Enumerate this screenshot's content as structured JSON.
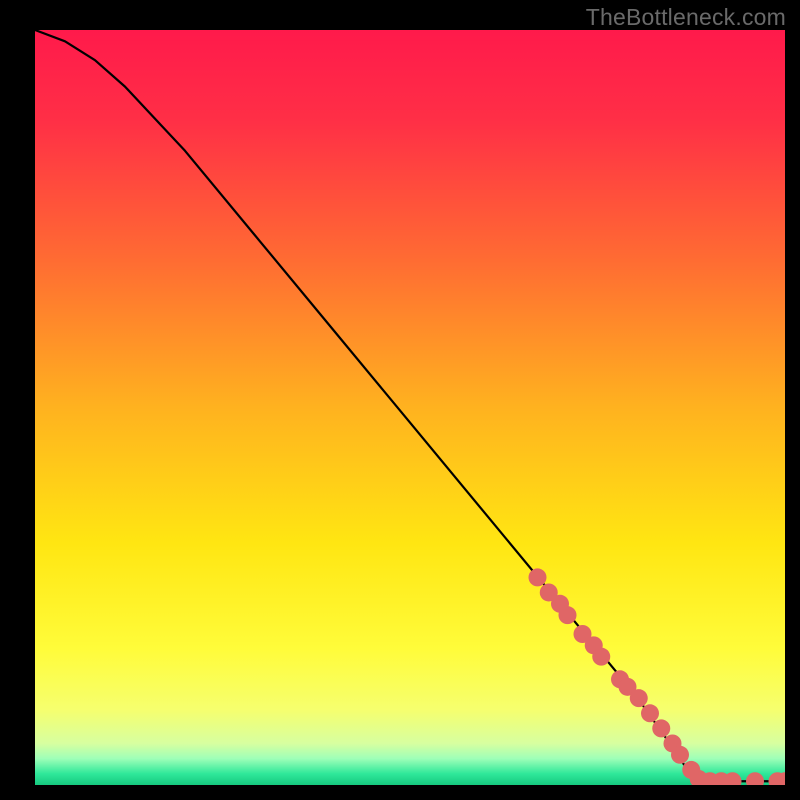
{
  "watermark": "TheBottleneck.com",
  "chart_data": {
    "type": "line",
    "title": "",
    "xlabel": "",
    "ylabel": "",
    "xlim": [
      0,
      100
    ],
    "ylim": [
      0,
      100
    ],
    "grid": false,
    "legend": false,
    "curve": {
      "comment": "Black descending curve; starts at top-left with slight outward bow then near-linear to bottom-right, flattening near x≈88.",
      "points": [
        {
          "x": 0,
          "y": 100
        },
        {
          "x": 4,
          "y": 98.5
        },
        {
          "x": 8,
          "y": 96
        },
        {
          "x": 12,
          "y": 92.5
        },
        {
          "x": 20,
          "y": 84
        },
        {
          "x": 30,
          "y": 72
        },
        {
          "x": 40,
          "y": 60
        },
        {
          "x": 50,
          "y": 48
        },
        {
          "x": 60,
          "y": 36
        },
        {
          "x": 70,
          "y": 24
        },
        {
          "x": 80,
          "y": 12
        },
        {
          "x": 85,
          "y": 5
        },
        {
          "x": 88,
          "y": 0.5
        },
        {
          "x": 92,
          "y": 0.5
        },
        {
          "x": 96,
          "y": 0.5
        },
        {
          "x": 100,
          "y": 0.5
        }
      ]
    },
    "markers": {
      "comment": "Salmon circular markers clustered on lower-right segment of curve and along baseline.",
      "color": "#e06666",
      "radius_px": 9,
      "points": [
        {
          "x": 67,
          "y": 27.5
        },
        {
          "x": 68.5,
          "y": 25.5
        },
        {
          "x": 70,
          "y": 24
        },
        {
          "x": 71,
          "y": 22.5
        },
        {
          "x": 73,
          "y": 20
        },
        {
          "x": 74.5,
          "y": 18.5
        },
        {
          "x": 75.5,
          "y": 17
        },
        {
          "x": 78,
          "y": 14
        },
        {
          "x": 79,
          "y": 13
        },
        {
          "x": 80.5,
          "y": 11.5
        },
        {
          "x": 82,
          "y": 9.5
        },
        {
          "x": 83.5,
          "y": 7.5
        },
        {
          "x": 85,
          "y": 5.5
        },
        {
          "x": 86,
          "y": 4
        },
        {
          "x": 87.5,
          "y": 2
        },
        {
          "x": 88.5,
          "y": 0.8
        },
        {
          "x": 90,
          "y": 0.5
        },
        {
          "x": 91.5,
          "y": 0.5
        },
        {
          "x": 93,
          "y": 0.5
        },
        {
          "x": 96,
          "y": 0.5
        },
        {
          "x": 99,
          "y": 0.5
        },
        {
          "x": 100,
          "y": 0.5
        }
      ]
    },
    "background_gradient": {
      "comment": "Vertical gradient inside plot area from red top through orange/yellow to narrow green band at bottom.",
      "stops": [
        {
          "offset": 0.0,
          "color": "#ff1a4b"
        },
        {
          "offset": 0.12,
          "color": "#ff2f46"
        },
        {
          "offset": 0.3,
          "color": "#ff6a33"
        },
        {
          "offset": 0.5,
          "color": "#ffb21f"
        },
        {
          "offset": 0.68,
          "color": "#ffe612"
        },
        {
          "offset": 0.82,
          "color": "#fffc3a"
        },
        {
          "offset": 0.9,
          "color": "#f6ff6e"
        },
        {
          "offset": 0.945,
          "color": "#d7ffa0"
        },
        {
          "offset": 0.965,
          "color": "#9effb8"
        },
        {
          "offset": 0.985,
          "color": "#2fe89a"
        },
        {
          "offset": 1.0,
          "color": "#16c97f"
        }
      ]
    }
  }
}
